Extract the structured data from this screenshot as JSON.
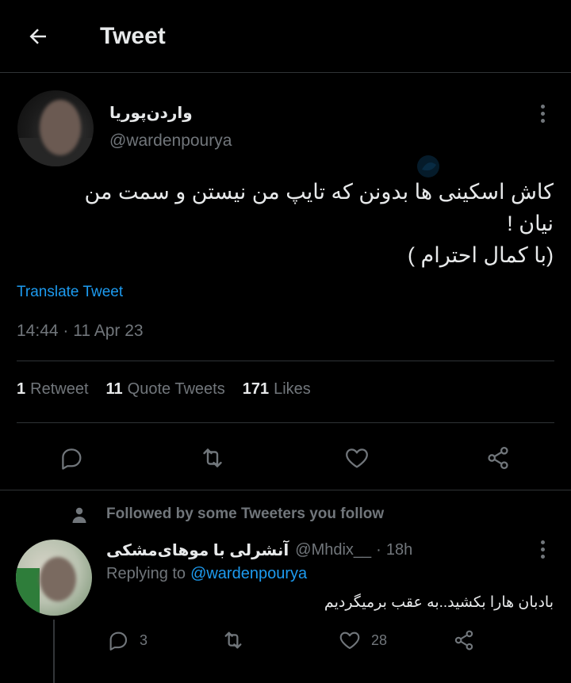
{
  "header": {
    "title": "Tweet",
    "back_icon": "arrow-left-icon"
  },
  "tweet": {
    "author_name": "واردن‌پوریا",
    "author_handle": "@wardenpourya",
    "text_lines": [
      "کاش اسکینی ها بدونن که تایپ من نیستن و سمت من",
      "نیان !",
      "(با کمال احترام )"
    ],
    "translate_label": "Translate Tweet",
    "timestamp": "14:44 · 11 Apr 23",
    "stats": {
      "retweets_count": "1",
      "retweets_label": "Retweet",
      "quotes_count": "11",
      "quotes_label": "Quote Tweets",
      "likes_count": "171",
      "likes_label": "Likes"
    },
    "actions": [
      "reply-icon",
      "retweet-icon",
      "like-icon",
      "share-icon"
    ]
  },
  "social_context": {
    "icon": "person-icon",
    "text": "Followed by some Tweeters you follow"
  },
  "reply": {
    "author_name": "آنشرلی با موهای‌مشکی",
    "author_handle": "@Mhdix__",
    "separator": "·",
    "time": "18h",
    "replying_to_label": "Replying to",
    "replying_to_handle": "@wardenpourya",
    "text": "بادبان هارا بکشید..به عقب برمیگردیم",
    "reply_count": "3",
    "retweet_count": "",
    "like_count": "28"
  },
  "colors": {
    "background": "#000000",
    "text_primary": "#e7e9ea",
    "text_secondary": "#71767b",
    "link": "#1d9bf0",
    "divider": "#2f3336"
  }
}
